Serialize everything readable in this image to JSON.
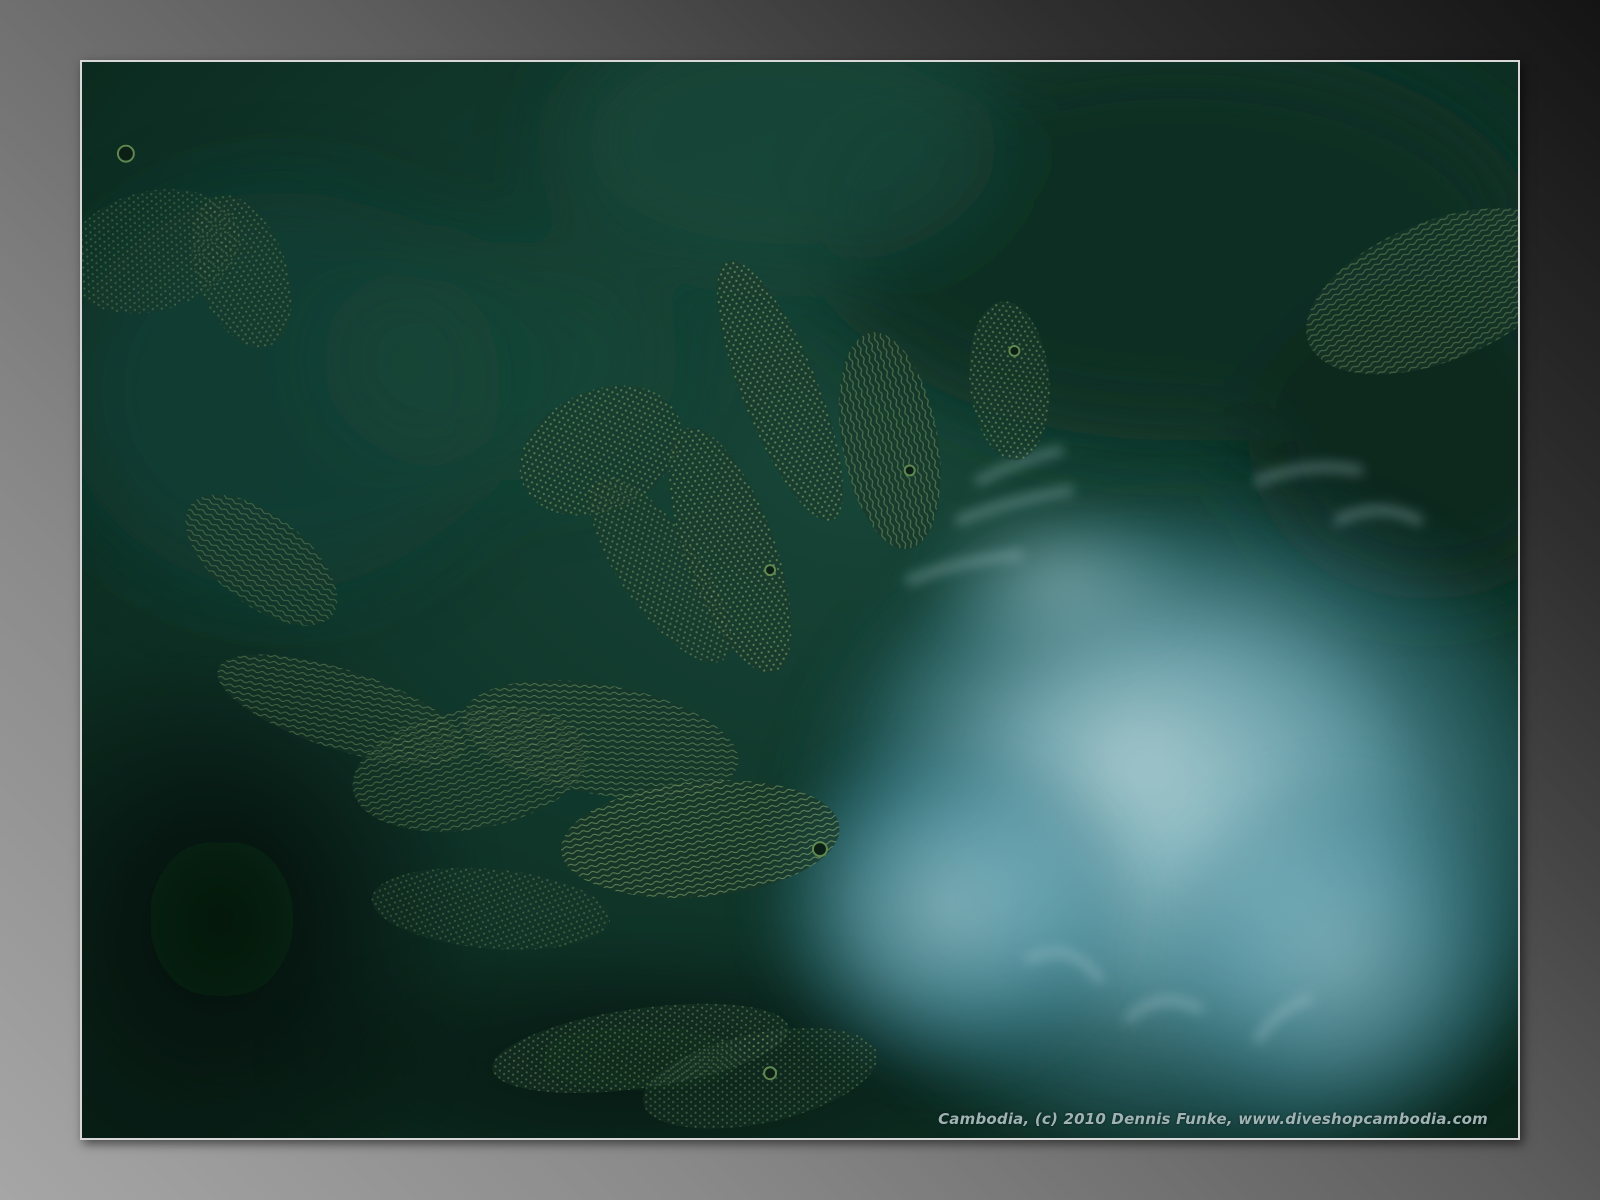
{
  "photo": {
    "subject": "underwater-fish-school",
    "caption": "Cambodia, (c) 2010 Dennis Funke, www.diveshopcambodia.com"
  },
  "colors": {
    "background_light": "#a6a6a6",
    "background_dark": "#141414",
    "frame_border": "#d8d8d8",
    "water_dark": "#0c2a22",
    "water_mid": "#143f33",
    "fish_body": "#1f3a2c",
    "fish_spots": "#b7d98a",
    "cloud": "#9fd3e6",
    "caption": "#9fb3b4"
  }
}
